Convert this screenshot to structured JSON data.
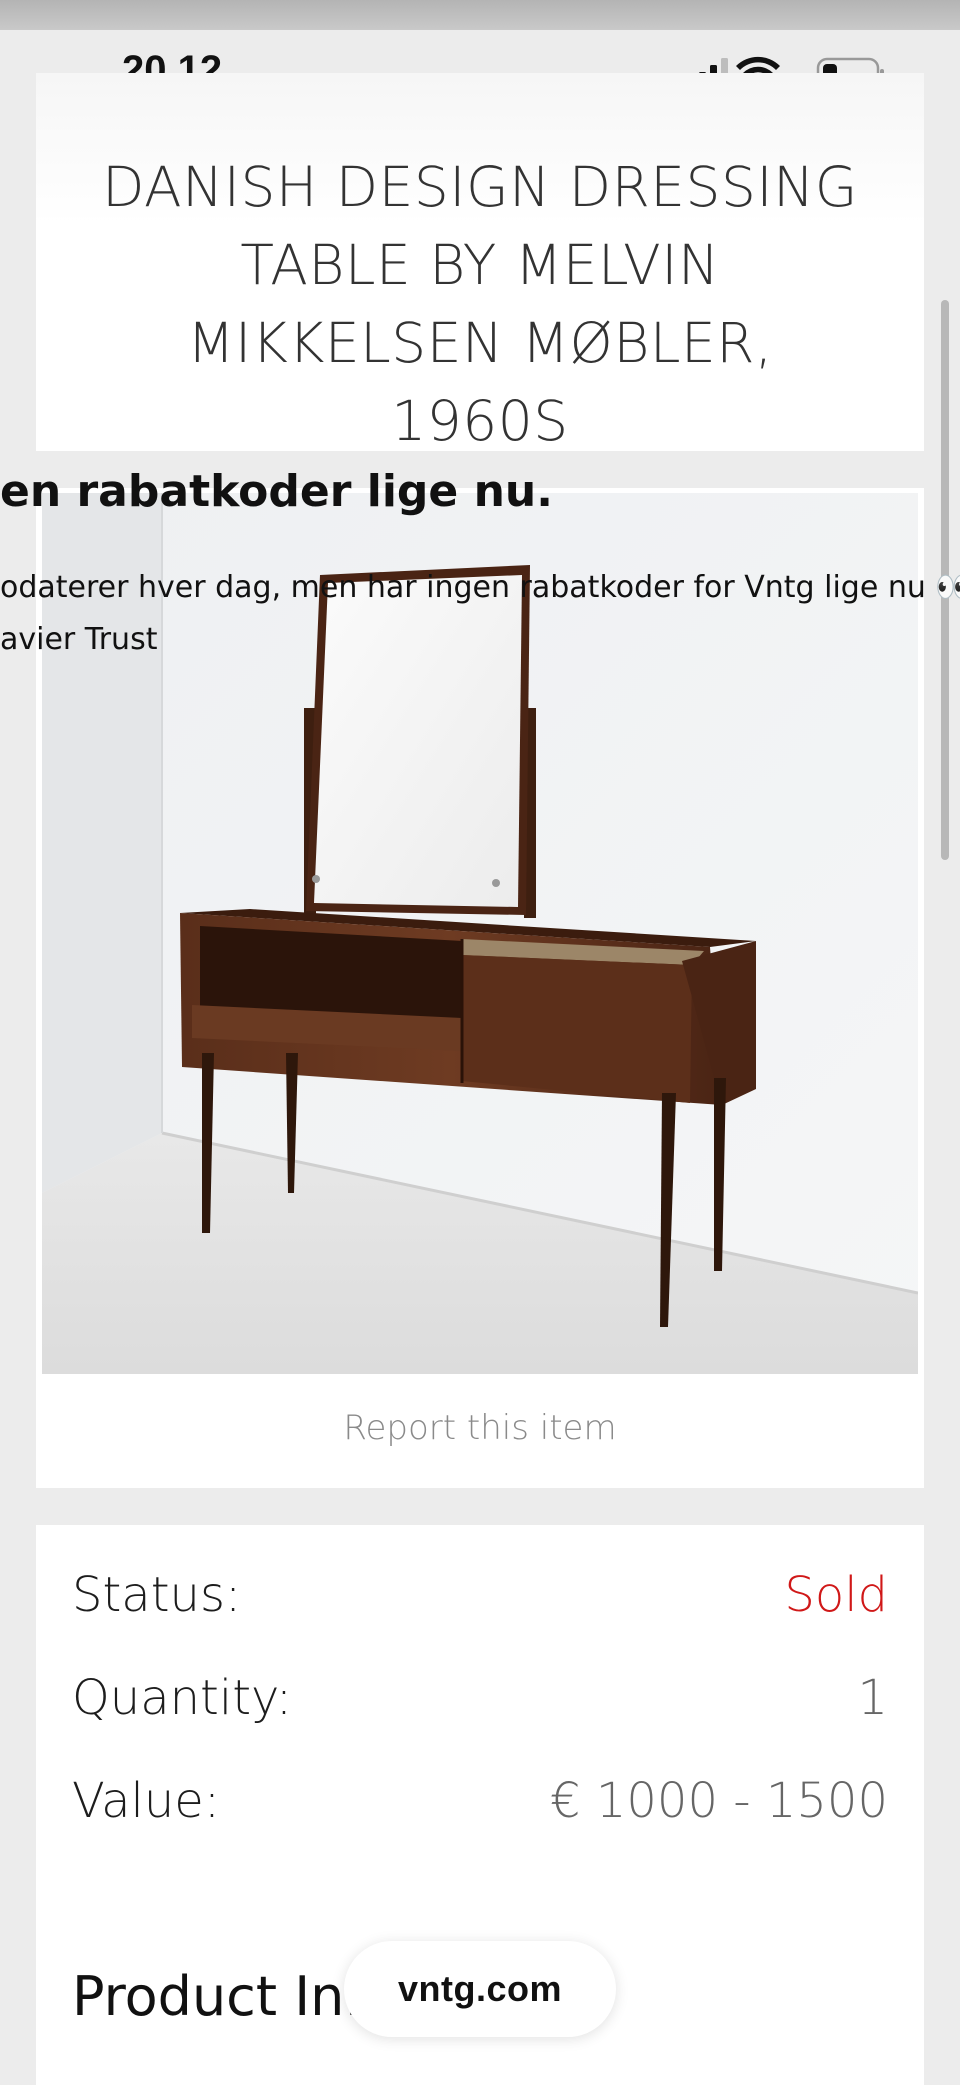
{
  "status_bar": {
    "time": "20.12",
    "icons": [
      "signal-icon",
      "wifi-icon",
      "battery-icon"
    ]
  },
  "product": {
    "title": "DANISH DESIGN DRESSING TABLE BY MELVIN MIKKELSEN MØBLER, 1960S",
    "report_link": "Report this item"
  },
  "overlay": {
    "heading": "en rabatkoder lige nu.",
    "line1": "odaterer hver dag, men har ingen rabatkoder for Vntg lige nu 👀",
    "line2": "avier Trust"
  },
  "details": {
    "status_label": "Status:",
    "status_value": "Sold",
    "quantity_label": "Quantity:",
    "quantity_value": "1",
    "value_label": "Value:",
    "value_value": "€ 1000 - 1500",
    "product_info_heading": "Product Inf"
  },
  "site_pill": "vntg.com",
  "colors": {
    "sold": "#d01818",
    "background": "#ececec",
    "card": "#ffffff"
  }
}
